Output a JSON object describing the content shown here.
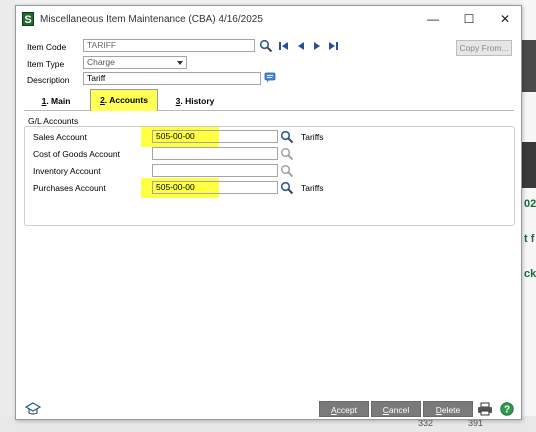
{
  "window": {
    "title": "Miscellaneous Item Maintenance (CBA) 4/16/2025",
    "minimize": "—",
    "maximize": "☐",
    "close": "✕"
  },
  "header": {
    "item_code_label": "Item Code",
    "item_code_value": "TARIFF",
    "item_type_label": "Item Type",
    "item_type_value": "Charge",
    "description_label": "Description",
    "description_value": "Tariff",
    "copy_from_label": "Copy From..."
  },
  "tabs": [
    {
      "num": "1",
      "label": ". Main",
      "active": false
    },
    {
      "num": "2",
      "label": ". Accounts",
      "active": true
    },
    {
      "num": "3",
      "label": ". History",
      "active": false
    }
  ],
  "gl": {
    "group_title": "G/L Accounts",
    "rows": [
      {
        "label": "Sales Account",
        "value": "505-00-00",
        "desc": "Tariffs",
        "highlight": true
      },
      {
        "label": "Cost of Goods Account",
        "value": "",
        "desc": "",
        "highlight": false
      },
      {
        "label": "Inventory Account",
        "value": "",
        "desc": "",
        "highlight": false
      },
      {
        "label": "Purchases Account",
        "value": "505-00-00",
        "desc": "Tariffs",
        "highlight": true
      }
    ]
  },
  "footer": {
    "accept": {
      "u": "A",
      "rest": "ccept"
    },
    "cancel": {
      "u": "C",
      "rest": "ancel"
    },
    "delete": {
      "u": "D",
      "rest": "elete"
    }
  },
  "background": {
    "frag1": "02",
    "frag2": "t f",
    "frag3": "ck",
    "num1": "332",
    "num2": "391"
  },
  "colors": {
    "highlight": "#ffff44",
    "button": "#7a7a7a",
    "app_icon": "#1e6b31"
  },
  "icons": [
    "search-icon",
    "first-record-icon",
    "previous-record-icon",
    "next-record-icon",
    "last-record-icon",
    "memo-icon",
    "help-icon",
    "print-icon",
    "graduation-cap-icon"
  ]
}
